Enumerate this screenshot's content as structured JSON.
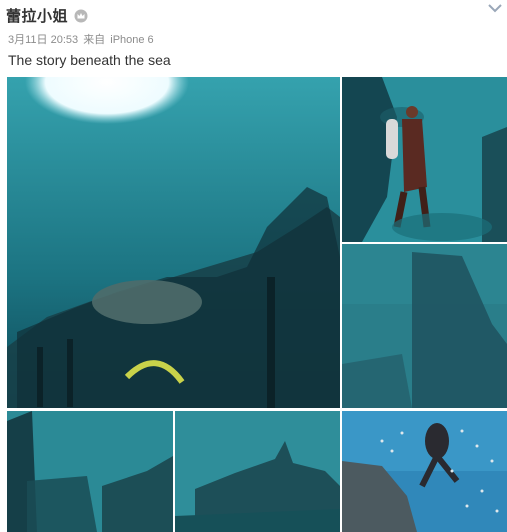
{
  "post": {
    "user_name": "蕾拉小姐",
    "badge_icon": "crown-icon",
    "date": "3月11日 20:53",
    "source_prefix": "来自",
    "source_device": "iPhone 6",
    "text": "The story beneath the sea",
    "menu_icon": "chevron-down-icon"
  },
  "photos": [
    {
      "subject": "shipwreck-with-sun"
    },
    {
      "subject": "diver"
    },
    {
      "subject": "wreck-hull"
    },
    {
      "subject": "wreck-left"
    },
    {
      "subject": "wreck-middle"
    },
    {
      "subject": "diver-with-fish"
    }
  ],
  "colors": {
    "water_light": "#3aa7b4",
    "water_dark": "#0e4f5e",
    "text_main": "#333333",
    "text_meta": "#8c8c8c"
  }
}
